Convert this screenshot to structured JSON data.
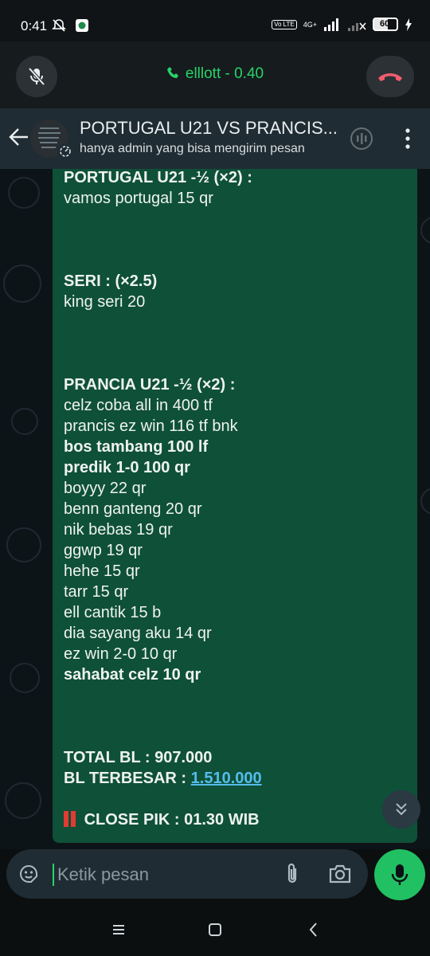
{
  "status_bar": {
    "time": "0:41",
    "network": "4G+",
    "volte": "Vo LTE",
    "battery": "60",
    "icons": [
      "bell-off-icon",
      "app-notification-icon",
      "signal-icon",
      "signal-no-service-icon",
      "charging-icon"
    ]
  },
  "call": {
    "label": "elllott - 0.40",
    "color": "#27d367"
  },
  "header": {
    "title": "PORTUGAL U21 VS PRANCIS...",
    "subtitle": "hanya admin yang bisa mengirim pesan"
  },
  "message": {
    "lines": [
      {
        "text": "PORTUGAL U21 -½ (×2) :",
        "bold": true
      },
      {
        "text": "vamos portugal 15 qr",
        "bold": false
      },
      {
        "text": "",
        "bold": false
      },
      {
        "text": "",
        "bold": false
      },
      {
        "text": "",
        "bold": false
      },
      {
        "text": "SERI : (×2.5)",
        "bold": true
      },
      {
        "text": "king seri 20",
        "bold": false
      },
      {
        "text": "",
        "bold": false
      },
      {
        "text": "",
        "bold": false
      },
      {
        "text": "",
        "bold": false
      },
      {
        "text": "PRANCIA U21 -½ (×2) :",
        "bold": true
      },
      {
        "text": "celz coba all in 400 tf",
        "bold": false
      },
      {
        "text": "prancis ez win 116 tf bnk",
        "bold": false
      },
      {
        "text": "bos tambang 100 lf",
        "bold": true
      },
      {
        "text": "predik 1-0 100 qr",
        "bold": true
      },
      {
        "text": "boyyy 22 qr",
        "bold": false
      },
      {
        "text": "benn ganteng 20 qr",
        "bold": false
      },
      {
        "text": "nik bebas 19 qr",
        "bold": false
      },
      {
        "text": "ggwp 19 qr",
        "bold": false
      },
      {
        "text": "hehe 15 qr",
        "bold": false
      },
      {
        "text": "tarr 15 qr",
        "bold": false
      },
      {
        "text": "ell cantik 15 b",
        "bold": false
      },
      {
        "text": "dia sayang aku 14 qr",
        "bold": false
      },
      {
        "text": "ez win 2-0 10 qr",
        "bold": false
      },
      {
        "text": "sahabat celz 10 qr",
        "bold": true
      },
      {
        "text": "",
        "bold": false
      },
      {
        "text": "",
        "bold": false
      },
      {
        "text": "",
        "bold": false
      }
    ],
    "total_label": "TOTAL BL : 907.000",
    "largest_label": "BL TERBESAR : ",
    "largest_value": "1.510.000",
    "close_text": "CLOSE PIK : 01.30 WIB"
  },
  "composer": {
    "placeholder": "Ketik pesan"
  }
}
